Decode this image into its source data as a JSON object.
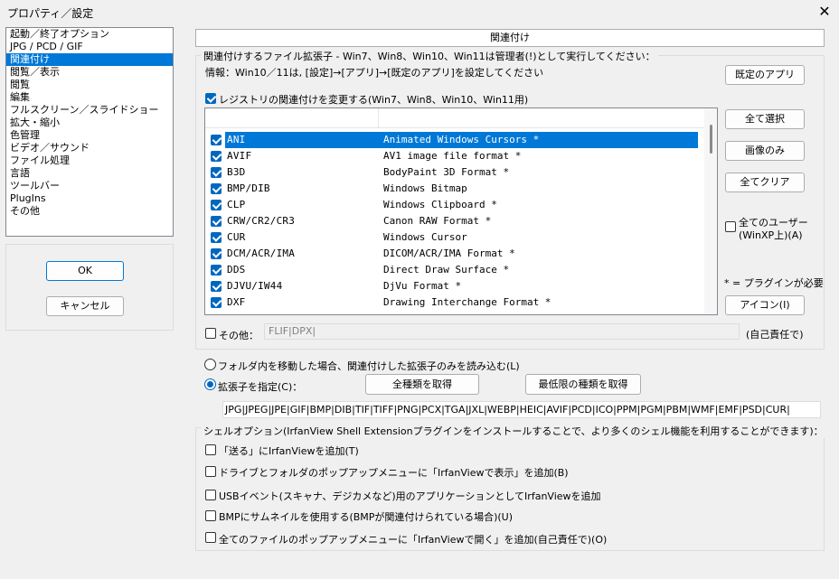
{
  "window": {
    "title": "プロパティ／設定",
    "close_label": "✕"
  },
  "sidebar": {
    "items": [
      {
        "label": "起動／終了オプション",
        "selected": false
      },
      {
        "label": "JPG / PCD / GIF",
        "selected": false
      },
      {
        "label": "関連付け",
        "selected": true
      },
      {
        "label": "閲覧／表示",
        "selected": false
      },
      {
        "label": "閲覧",
        "selected": false
      },
      {
        "label": "編集",
        "selected": false
      },
      {
        "label": "フルスクリーン／スライドショー",
        "selected": false
      },
      {
        "label": "拡大・縮小",
        "selected": false
      },
      {
        "label": "色管理",
        "selected": false
      },
      {
        "label": "ビデオ／サウンド",
        "selected": false
      },
      {
        "label": "ファイル処理",
        "selected": false
      },
      {
        "label": "言語",
        "selected": false
      },
      {
        "label": "ツールバー",
        "selected": false
      },
      {
        "label": "PlugIns",
        "selected": false
      },
      {
        "label": "その他",
        "selected": false
      }
    ],
    "ok_label": "OK",
    "cancel_label": "キャンセル"
  },
  "main": {
    "section_title": "関連付け",
    "group_title": "関連付けするファイル拡張子 - Win7、Win8、Win10、Win11は管理者(!)として実行してください：",
    "info_text": "情報：Win10／11は, [設定]→[アプリ]→[既定のアプリ]を設定してください",
    "default_apps_button": "既定のアプリ",
    "registry_checkbox_label": "レジストリの関連付けを変更する(Win7、Win8、Win10、Win11用)",
    "registry_checked": true,
    "extensions": [
      {
        "ext": "ANI",
        "desc": "Animated Windows Cursors *",
        "checked": true,
        "selected": true
      },
      {
        "ext": "AVIF",
        "desc": "AV1 image file format *",
        "checked": true,
        "selected": false
      },
      {
        "ext": "B3D",
        "desc": "BodyPaint 3D Format *",
        "checked": true,
        "selected": false
      },
      {
        "ext": "BMP/DIB",
        "desc": "Windows Bitmap",
        "checked": true,
        "selected": false
      },
      {
        "ext": "CLP",
        "desc": "Windows Clipboard *",
        "checked": true,
        "selected": false
      },
      {
        "ext": "CRW/CR2/CR3",
        "desc": "Canon RAW Format *",
        "checked": true,
        "selected": false
      },
      {
        "ext": "CUR",
        "desc": "Windows Cursor",
        "checked": true,
        "selected": false
      },
      {
        "ext": "DCM/ACR/IMA",
        "desc": "DICOM/ACR/IMA Format *",
        "checked": true,
        "selected": false
      },
      {
        "ext": "DDS",
        "desc": "Direct Draw Surface *",
        "checked": true,
        "selected": false
      },
      {
        "ext": "DJVU/IW44",
        "desc": "DjVu Format *",
        "checked": true,
        "selected": false
      },
      {
        "ext": "DXF",
        "desc": "Drawing Interchange Format *",
        "checked": true,
        "selected": false
      }
    ],
    "select_all_button": "全て選択",
    "images_only_button": "画像のみ",
    "clear_all_button": "全てクリア",
    "all_users_label_line1": "全てのユーザー",
    "all_users_label_line2": "(WinXP上)(A)",
    "all_users_checked": false,
    "plugin_note": "* = プラグインが必要",
    "icon_button": "アイコン(I)",
    "other_checkbox_label": "その他：",
    "other_checked": false,
    "other_field_value": "FLIF|DPX|",
    "own_risk_label": "(自己責任で)",
    "radio_folder_label": "フォルダ内を移動した場合、関連付けした拡張子のみを読み込む(L)",
    "radio_folder_checked": false,
    "radio_ext_label": "拡張子を指定(C)：",
    "radio_ext_checked": true,
    "get_all_types_button": "全種類を取得",
    "get_min_types_button": "最低限の種類を取得",
    "extensions_field_value": "JPG|JPEG|JPE|GIF|BMP|DIB|TIF|TIFF|PNG|PCX|TGA|JXL|WEBP|HEIC|AVIF|PCD|ICO|PPM|PGM|PBM|WMF|EMF|PSD|CUR|"
  },
  "shell": {
    "group_title": "シェルオプション(IrfanView Shell Extensionプラグインをインストールすることで、より多くのシェル機能を利用することができます)：",
    "options": [
      {
        "label": "「送る」にIrfanViewを追加(T)",
        "checked": false
      },
      {
        "label": "ドライブとフォルダのポップアップメニューに「IrfanViewで表示」を追加(B)",
        "checked": false
      },
      {
        "label": "USBイベント(スキャナ、デジカメなど)用のアプリケーションとしてIrfanViewを追加",
        "checked": false
      },
      {
        "label": "BMPにサムネイルを使用する(BMPが関連付けられている場合)(U)",
        "checked": false
      },
      {
        "label": "全てのファイルのポップアップメニューに「IrfanViewで開く」を追加(自己責任で)(O)",
        "checked": false
      }
    ]
  },
  "colors": {
    "accent": "#0078d7",
    "checkbox": "#0067c0"
  }
}
